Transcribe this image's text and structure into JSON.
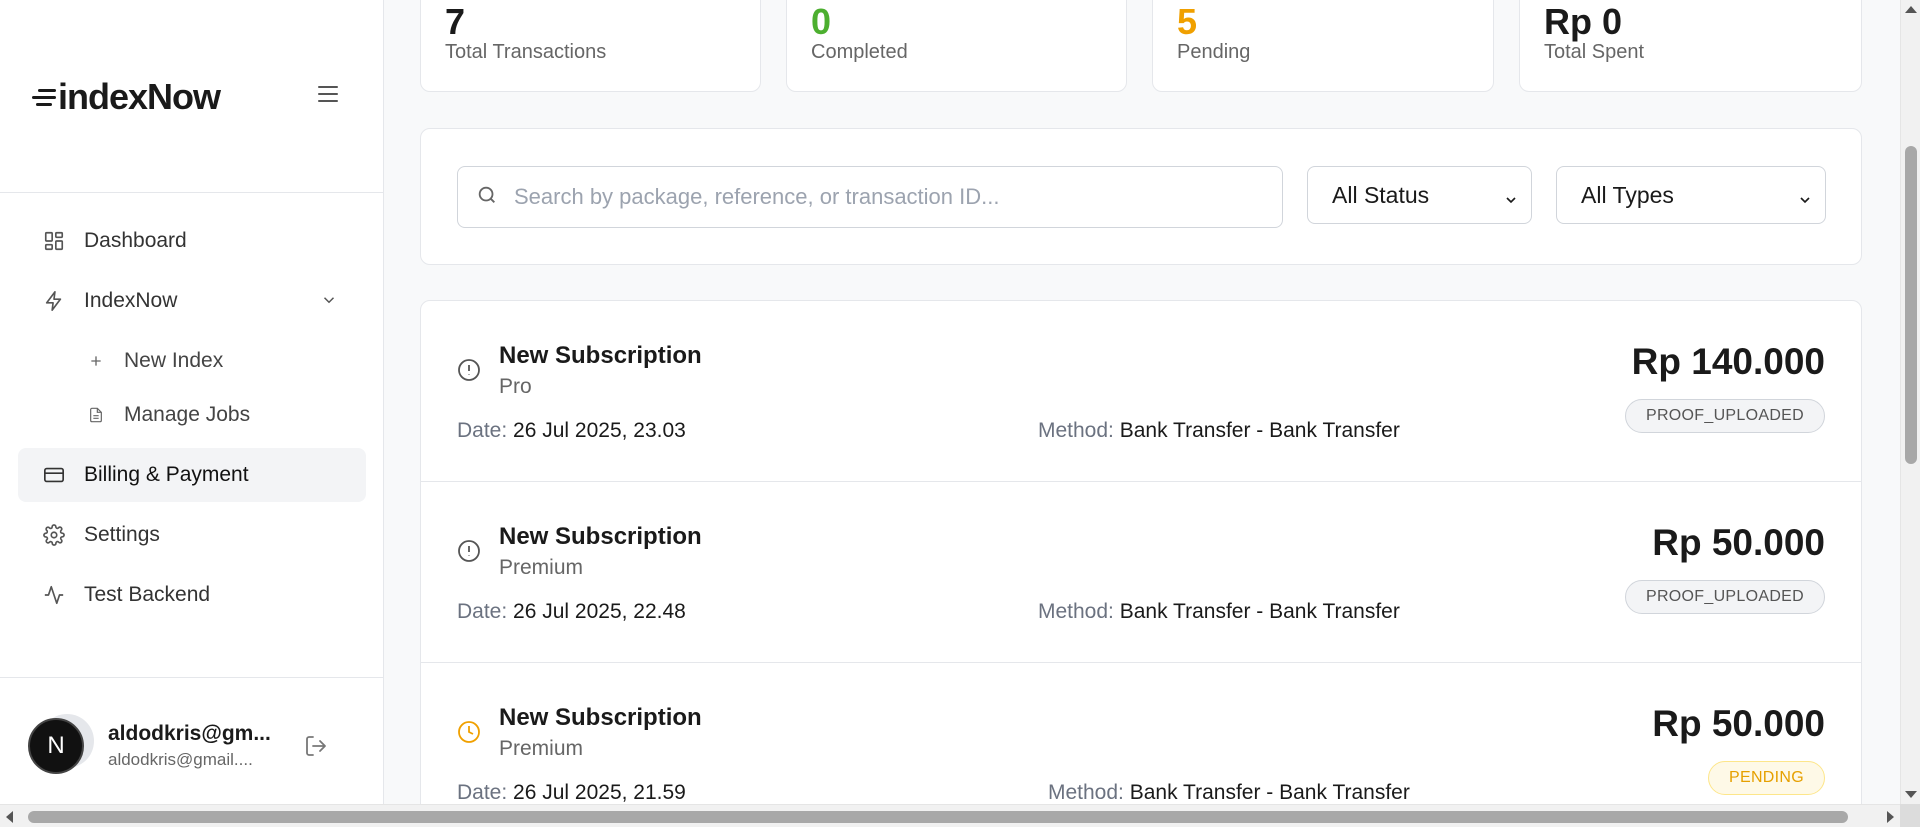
{
  "brand": {
    "logo_text": "indexNow"
  },
  "sidebar": {
    "items": [
      {
        "label": "Dashboard",
        "icon": "dashboard-grid-icon"
      },
      {
        "label": "IndexNow",
        "icon": "lightning-icon",
        "expanded": true,
        "children": [
          {
            "label": "New Index",
            "icon": "plus-icon"
          },
          {
            "label": "Manage Jobs",
            "icon": "document-icon"
          }
        ]
      },
      {
        "label": "Billing & Payment",
        "icon": "credit-card-icon",
        "active": true
      },
      {
        "label": "Settings",
        "icon": "gear-icon"
      },
      {
        "label": "Test Backend",
        "icon": "activity-icon"
      }
    ]
  },
  "user": {
    "initial": "N",
    "name": "aldodkris@gm...",
    "email": "aldodkris@gmail...."
  },
  "stats": [
    {
      "value": "7",
      "label": "Total Transactions",
      "color": "#1a1a1a"
    },
    {
      "value": "0",
      "label": "Completed",
      "color": "#4caf2f"
    },
    {
      "value": "5",
      "label": "Pending",
      "color": "#f0a000"
    },
    {
      "value": "Rp 0",
      "label": "Total Spent",
      "color": "#1a1a1a"
    }
  ],
  "filters": {
    "search_placeholder": "Search by package, reference, or transaction ID...",
    "status_selected": "All Status",
    "type_selected": "All Types"
  },
  "transactions": [
    {
      "title": "New Subscription",
      "plan": "Pro",
      "date_label": "Date:",
      "date": "26 Jul 2025, 23.03",
      "method_label": "Method:",
      "method": "Bank Transfer - Bank Transfer",
      "amount": "Rp 140.000",
      "status": "PROOF_UPLOADED",
      "status_icon": "alert-circle-icon"
    },
    {
      "title": "New Subscription",
      "plan": "Premium",
      "date_label": "Date:",
      "date": "26 Jul 2025, 22.48",
      "method_label": "Method:",
      "method": "Bank Transfer - Bank Transfer",
      "amount": "Rp 50.000",
      "status": "PROOF_UPLOADED",
      "status_icon": "alert-circle-icon"
    },
    {
      "title": "New Subscription",
      "plan": "Premium",
      "date_label": "Date:",
      "date": "26 Jul 2025, 21.59",
      "method_label": "Method:",
      "method": "Bank Transfer - Bank Transfer",
      "amount": "Rp 50.000",
      "status": "PENDING",
      "status_icon": "clock-icon"
    }
  ]
}
